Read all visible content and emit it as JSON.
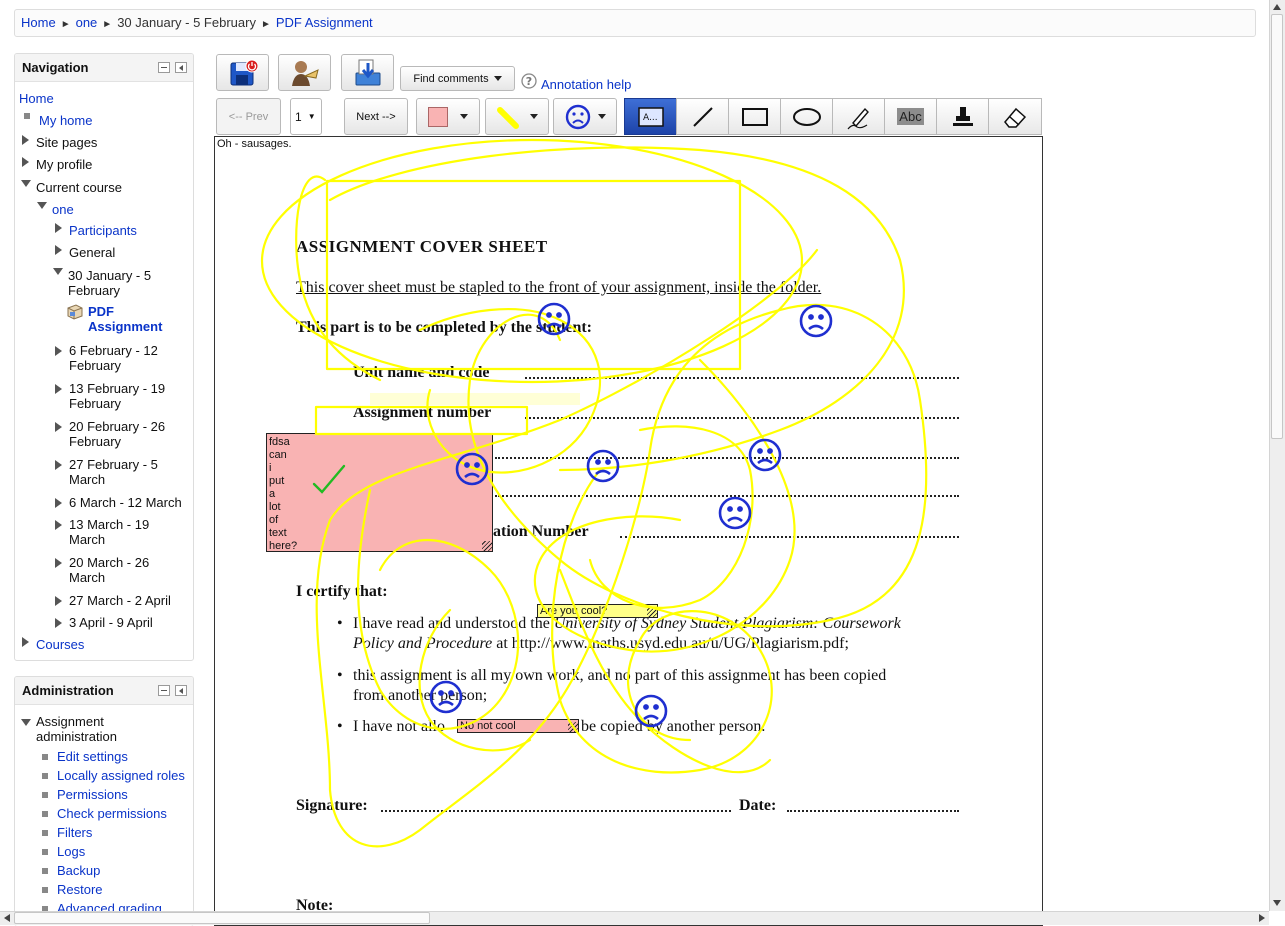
{
  "breadcrumb": {
    "home": "Home",
    "course": "one",
    "week": "30 January - 5 February",
    "current": "PDF Assignment",
    "separator": "►"
  },
  "navigation": {
    "title": "Navigation",
    "home": "Home",
    "my_home": "My home",
    "site_pages": "Site pages",
    "my_profile": "My profile",
    "current_course": "Current course",
    "course_one": "one",
    "participants": "Participants",
    "general": "General",
    "week_current": "30 January - 5 February",
    "assignment": "PDF Assignment",
    "weeks": [
      "6 February - 12 February",
      "13 February - 19 February",
      "20 February - 26 February",
      "27 February - 5 March",
      "6 March - 12 March",
      "13 March - 19 March",
      "20 March - 26 March",
      "27 March - 2 April",
      "3 April - 9 April"
    ],
    "courses": "Courses"
  },
  "administration": {
    "title": "Administration",
    "section": "Assignment administration",
    "items": [
      "Edit settings",
      "Locally assigned roles",
      "Permissions",
      "Check permissions",
      "Filters",
      "Logs",
      "Backup",
      "Restore",
      "Advanced grading"
    ]
  },
  "toolbar": {
    "find_comments": "Find comments",
    "annotation_help": "Annotation help",
    "prev": "<-- Prev",
    "page": "1",
    "next": "Next -->",
    "text_tool_label": "Abc",
    "colors": {
      "comment": "#f9b3b3",
      "pen": "#ffff00",
      "stamp": "#1f2fd0",
      "selected_tool": "#1d43a8"
    },
    "icons": [
      "save-submit-icon",
      "return-to-grading-icon",
      "download-icon",
      "help-icon",
      "comment-color-swatch",
      "pen-color-swatch",
      "sad-face-stamp-icon",
      "comment-tool-icon",
      "line-tool-icon",
      "rectangle-tool-icon",
      "oval-tool-icon",
      "freehand-tool-icon",
      "highlight-tool-icon",
      "stamp-tool-icon",
      "eraser-tool-icon"
    ]
  },
  "document": {
    "note_top": "Oh - sausages.",
    "title": "ASSIGNMENT COVER SHEET",
    "subtitle": "This cover sheet must be stapled to the front of your assignment, inside the folder.",
    "section": "This part is to be completed by the student:",
    "unit": "Unit name and code",
    "assignment_number": "Assignment number",
    "registration": "ation Number",
    "certify": "I certify that:",
    "bullet1_a": "I have read and understood the ",
    "bullet1_italic": "University of Sydney Student Plagiarism: Coursework",
    "bullet1_b_italic": "Policy and Procedure",
    "bullet1_c": " at http://www.maths.usyd.edu.au/u/UG/Plagiarism.pdf;",
    "bullet2_a": "this assignment is all my own work, and no part of this assignment has been copied",
    "bullet2_b": "from another person;",
    "bullet3_a": "I have not allo",
    "bullet3_b": "be copied by another person.",
    "signature": "Signature:",
    "date": "Date:",
    "note": "Note:"
  },
  "comments": {
    "pink_box": "fdsa\ncan\ni\nput\na\nlot\nof\ntext\nhere?",
    "yellow": "Are you cool?",
    "pink_small": "No not cool"
  }
}
